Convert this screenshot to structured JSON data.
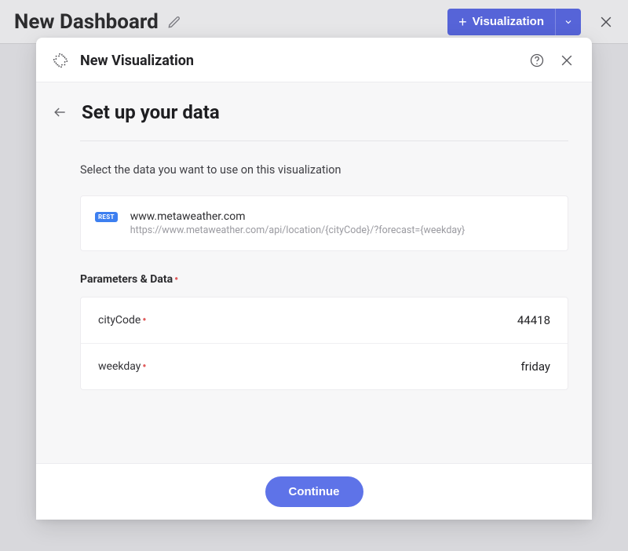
{
  "topbar": {
    "title": "New Dashboard",
    "viz_button": "Visualization"
  },
  "modal": {
    "title": "New Visualization",
    "body_title": "Set up your data",
    "description": "Select the data you want to use on this visualization",
    "data_source": {
      "badge": "REST",
      "host": "www.metaweather.com",
      "url": "https://www.metaweather.com/api/location/{cityCode}/?forecast={weekday}"
    },
    "params_heading": "Parameters & Data",
    "params": [
      {
        "name": "cityCode",
        "required": true,
        "value": "44418"
      },
      {
        "name": "weekday",
        "required": true,
        "value": "friday"
      }
    ],
    "continue": "Continue"
  }
}
